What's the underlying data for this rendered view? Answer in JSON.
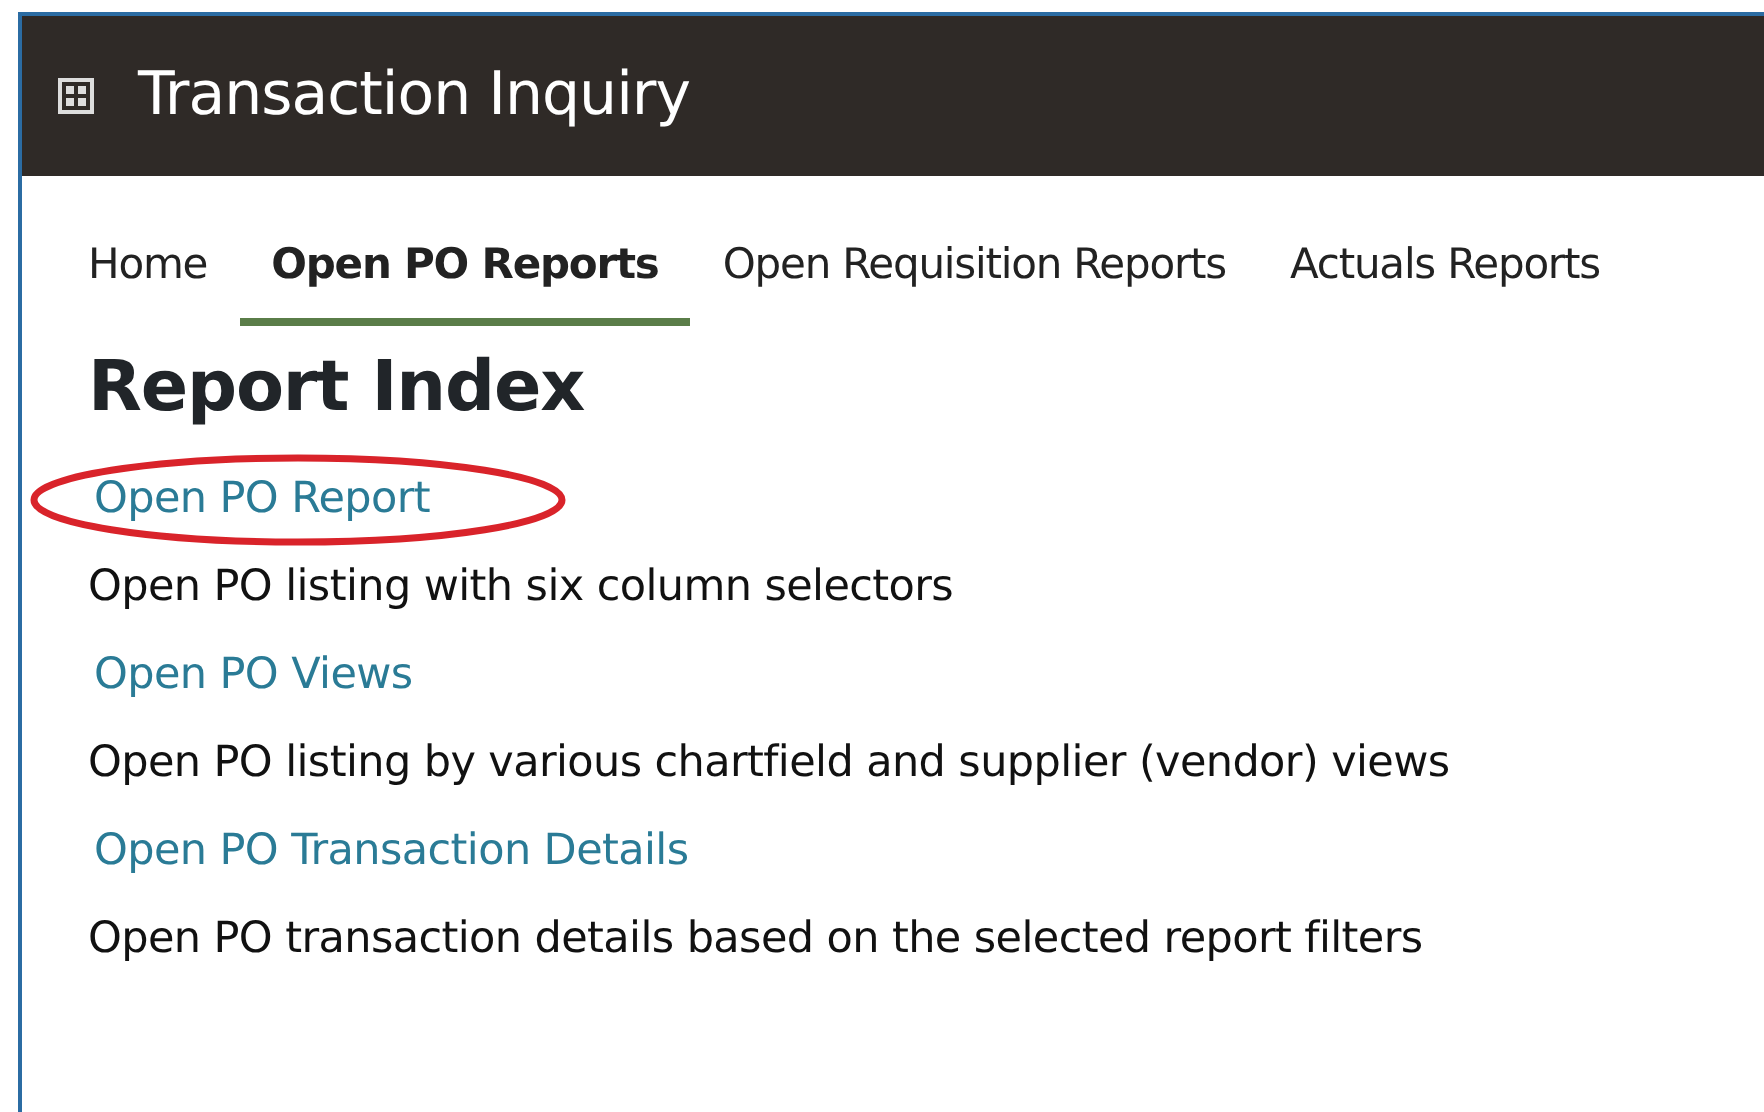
{
  "window": {
    "title": "Transaction Inquiry"
  },
  "tabs": [
    {
      "label": "Home",
      "selected": false
    },
    {
      "label": "Open PO Reports",
      "selected": true
    },
    {
      "label": "Open Requisition Reports",
      "selected": false
    },
    {
      "label": "Actuals Reports",
      "selected": false
    }
  ],
  "heading": "Report Index",
  "reports": [
    {
      "link": "Open PO Report",
      "description": "Open PO listing with six column selectors",
      "circled": true
    },
    {
      "link": "Open PO Views",
      "description": "Open PO listing by various chartfield and supplier (vendor) views",
      "circled": false
    },
    {
      "link": "Open PO Transaction Details",
      "description": "Open PO transaction details based on the selected report filters",
      "circled": false
    }
  ]
}
